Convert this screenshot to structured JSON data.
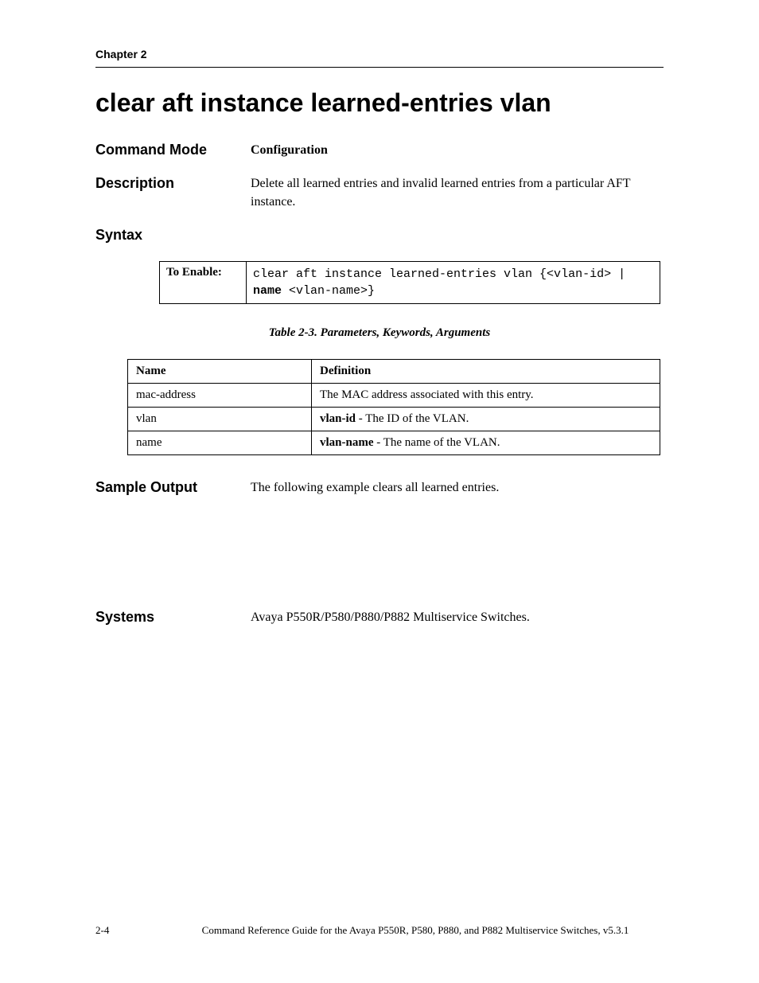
{
  "running_header": "Chapter 2",
  "title": "clear aft instance learned-entries vlan",
  "rows": {
    "command_mode": {
      "label": "Command Mode",
      "value": "Configuration"
    },
    "description": {
      "label": "Description",
      "value": "Delete all learned entries and invalid learned entries from a particular AFT instance."
    },
    "syntax_label": "Syntax",
    "sample_output": {
      "label": "Sample Output",
      "value": "The following example clears all learned entries."
    },
    "systems": {
      "label": "Systems",
      "value": "Avaya P550R/P580/P880/P882 Multiservice Switches."
    }
  },
  "syntax_box": {
    "enable_label": "To Enable:",
    "code_plain1": "clear aft instance learned-entries vlan {<vlan-id> | ",
    "code_kw": "name",
    "code_plain2": " <vlan-name>}"
  },
  "params_caption": "Table 2-3.  Parameters, Keywords, Arguments",
  "params_header": {
    "name": "Name",
    "definition": "Definition"
  },
  "params": [
    {
      "name": "mac-address",
      "def_bold": "",
      "def_rest": "The MAC address associated with this entry."
    },
    {
      "name": "vlan",
      "def_bold": "vlan-id",
      "def_rest": " - The ID of the VLAN."
    },
    {
      "name": "name",
      "def_bold": "vlan-name",
      "def_rest": " - The name of the VLAN."
    }
  ],
  "footer": {
    "pagenum": "2-4",
    "text": "Command Reference Guide for the Avaya P550R, P580, P880, and P882 Multiservice Switches, v5.3.1"
  }
}
